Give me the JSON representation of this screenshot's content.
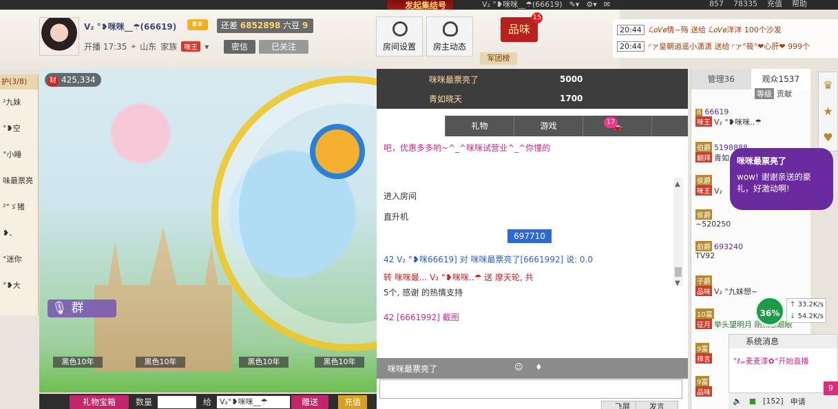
{
  "topbar": {
    "promo": "发起集结号",
    "user": "V₂ °❥咪咪__☂(66619)",
    "coins": "857",
    "beans": "78335",
    "recharge": "充值",
    "help": "帮助"
  },
  "anchor": {
    "name": "V₂ °❥咪咪__☂(66619)",
    "level": "8",
    "gap_label": "还差",
    "gap_value": "6852898",
    "gap_unit": "六豆",
    "next_level": "9",
    "broadcast_time": "开播 17:35",
    "location": "山东",
    "family_label": "家族",
    "family_tag": "咪王",
    "secret_btn": "密信",
    "follow_btn": "已关注"
  },
  "toolbar": {
    "room_settings": "房间设置",
    "host_dynamic": "房主动态",
    "pinwei": "品味",
    "pinwei_count": "15",
    "army_tab": "军团榜"
  },
  "notices": [
    {
      "time": "20:44",
      "text": "ℒ𝑜𝑉𝑒情~殇 送给 ℒ𝑜𝑉𝑒洋洋 100个沙发"
    },
    {
      "time": "20:44",
      "text": "◜ァ皇朝逍遥小潇潇 送给 ◜ァ°筱°❤心肝❤ 999个"
    }
  ],
  "guards": {
    "title": "护(3/8)",
    "items": [
      "²九妹",
      "°❥空",
      "°小睡",
      "味最票亮",
      "²°ゞ猪",
      "❥、",
      "°迷你",
      "°❥大"
    ]
  },
  "video": {
    "wealth": "425,334",
    "wealth_icon": "财",
    "mic_label": "群",
    "black_tags": [
      "黑色10年",
      "黑色10年",
      "黑色10年",
      "黑色10年"
    ]
  },
  "giftbar": {
    "gift_box": "礼物宝箱",
    "qty_label": "数量",
    "to_label": "给",
    "target": "V₂°❥咪咪__☂",
    "send": "赠送",
    "recharge": "充值"
  },
  "rank": [
    {
      "name": "咪咪最票亮了",
      "amount": "5000"
    },
    {
      "name": "青如晓天",
      "amount": "1700"
    }
  ],
  "chat": {
    "tabs": [
      "",
      "礼物",
      "游戏",
      ""
    ],
    "car_count": "17",
    "messages": [
      {
        "text": "吧，优惠多多哟~^_^咪咪试营业^_^你懂的"
      },
      {
        "text": "进入房间"
      },
      {
        "text": "直升机"
      },
      {
        "text": "42 V₂ °❥咪66619] 对 咪咪最票亮了[6661992] 说: 0.0"
      },
      {
        "text": "转 咪咪最... V₂ °❥咪咪..☂ 送 摩天轮, 共"
      },
      {
        "text": "5个, 感谢 的热情支持"
      },
      {
        "text": "42 [6661992] 截图"
      }
    ],
    "num_badge": "697710",
    "input_bar_user": "咪咪最票亮了",
    "fly_btn": "飞屏",
    "send_btn": "发言"
  },
  "audience": {
    "tab_admin": "管理36",
    "tab_viewers": "观众1537",
    "sub_level": "等级",
    "sub_contrib": "贡献",
    "users": [
      {
        "rank": "8",
        "fam": "咪王",
        "name": "V₂ °❥咪咪..☂",
        "id": "66619"
      },
      {
        "rank": "伯爵",
        "fam": "翻拜",
        "name": "青如",
        "id": "5198888"
      },
      {
        "rank": "侯爵",
        "fam": "咪王",
        "name": "V₂",
        "id": ""
      },
      {
        "rank": "侯爵",
        "fam": "",
        "name": "~520250",
        "id": ""
      },
      {
        "rank": "伯爵",
        "fam": "",
        "name": "TV92",
        "id": "693240"
      },
      {
        "rank": "子爵",
        "fam": "品味",
        "name": "V₂ °九妹想~",
        "id": ""
      },
      {
        "rank": "10富",
        "fam": "征月",
        "name": "举头望明月 刚点想跟眼",
        "id": ""
      },
      {
        "rank": "9富",
        "fam": "择言",
        "name": "",
        "id": ""
      },
      {
        "rank": "9富",
        "fam": "品味",
        "name": "",
        "id": ""
      }
    ],
    "speech_title": "咪咪最票亮了",
    "speech_text": "wow! 谢谢亲送的豪礼，好激动啊!",
    "speed_pct": "36%",
    "speed_up": "33.2K/s",
    "speed_down": "54.2K/s",
    "sys_title": "系统消息",
    "sys_text": "°ℓ𝓌麦麦漆✿°开始直播",
    "sys_count": "[152]",
    "sys_apply": "申请",
    "pink_badge": "9"
  }
}
